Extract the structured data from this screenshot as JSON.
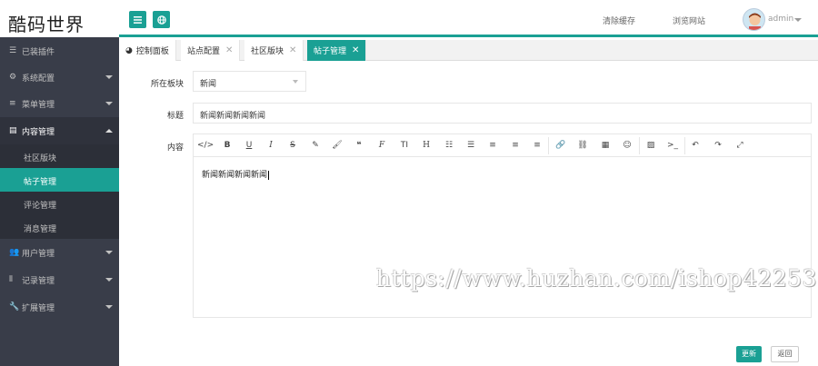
{
  "app": {
    "logo": "酷码世界"
  },
  "header": {
    "menu_icon": "hamburger-icon",
    "globe_icon": "globe-icon",
    "clear_cache": "清除缓存",
    "browse_site": "浏览网站",
    "user_name": "admin"
  },
  "sidebar": {
    "items": [
      {
        "label": "已装插件",
        "icon": "sliders-icon"
      },
      {
        "label": "系统配置",
        "icon": "gears-icon"
      },
      {
        "label": "菜单管理",
        "icon": "list-icon"
      },
      {
        "label": "内容管理",
        "icon": "file-icon"
      },
      {
        "label": "用户管理",
        "icon": "users-icon"
      },
      {
        "label": "记录管理",
        "icon": "barcode-icon"
      },
      {
        "label": "扩展管理",
        "icon": "wrench-icon"
      }
    ],
    "sub_items": [
      {
        "label": "社区版块"
      },
      {
        "label": "帖子管理"
      },
      {
        "label": "评论管理"
      },
      {
        "label": "消息管理"
      }
    ]
  },
  "tabs": [
    {
      "label": "控制面板"
    },
    {
      "label": "站点配置"
    },
    {
      "label": "社区版块"
    },
    {
      "label": "帖子管理"
    }
  ],
  "form": {
    "section_label": "所在板块",
    "section_value": "新闻",
    "title_label": "标题",
    "title_value": "新闻新闻新闻新闻",
    "content_label": "内容",
    "content_value": "新闻新闻新闻新闻"
  },
  "watermark": "https://www.huzhan.com/ishop42253",
  "buttons": {
    "update": "更新",
    "back": "返回"
  },
  "colors": {
    "accent": "#1aa094",
    "sidebar_bg": "#393d49"
  }
}
